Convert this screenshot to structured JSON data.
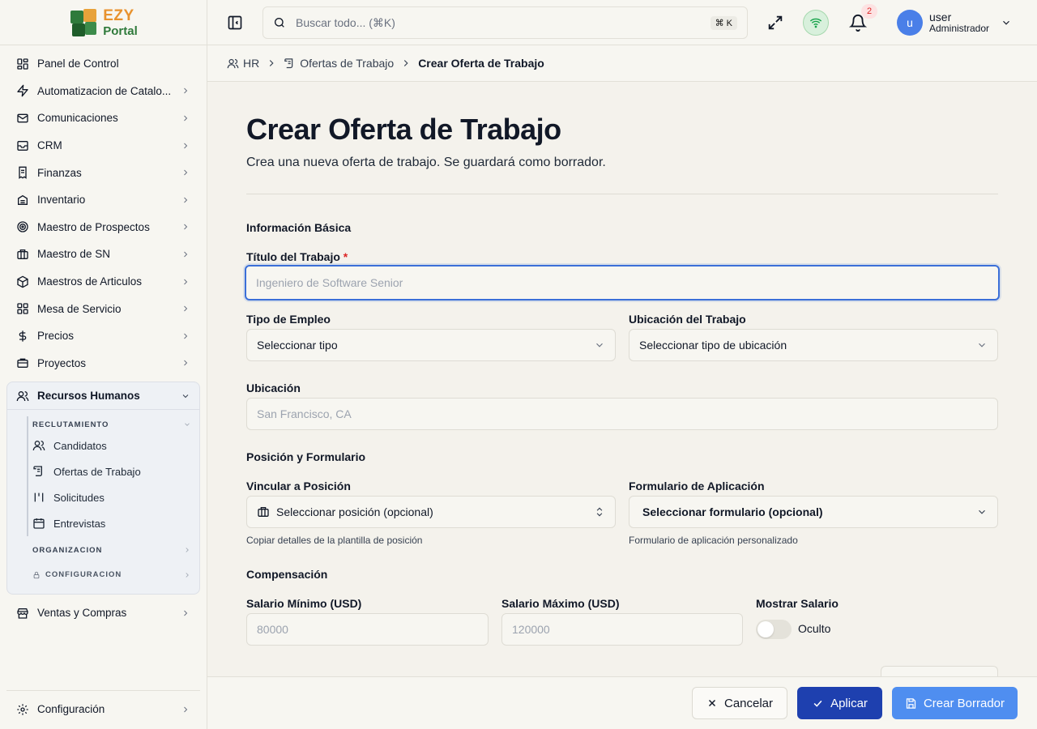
{
  "brand": {
    "line1": "EZY",
    "line2": "Portal"
  },
  "sidebar": {
    "items": [
      {
        "label": "Panel de Control",
        "icon": "dashboard-icon",
        "chevron": false
      },
      {
        "label": "Automatizacion de Catalo...",
        "icon": "zap-icon",
        "chevron": true
      },
      {
        "label": "Comunicaciones",
        "icon": "mail-icon",
        "chevron": true
      },
      {
        "label": "CRM",
        "icon": "inbox-icon",
        "chevron": true
      },
      {
        "label": "Finanzas",
        "icon": "receipt-icon",
        "chevron": true
      },
      {
        "label": "Inventario",
        "icon": "database-icon",
        "chevron": true
      },
      {
        "label": "Maestro de Prospectos",
        "icon": "target-icon",
        "chevron": true
      },
      {
        "label": "Maestro de SN",
        "icon": "briefcase-icon",
        "chevron": true
      },
      {
        "label": "Maestros de Articulos",
        "icon": "package-icon",
        "chevron": true
      },
      {
        "label": "Mesa de Servicio",
        "icon": "grid-icon",
        "chevron": true
      },
      {
        "label": "Precios",
        "icon": "dollar-icon",
        "chevron": true
      },
      {
        "label": "Proyectos",
        "icon": "folder-icon",
        "chevron": true
      }
    ],
    "hr": {
      "label": "Recursos Humanos",
      "reclutamiento": "RECLUTAMIENTO",
      "sub_items": [
        {
          "label": "Candidatos",
          "icon": "users-icon"
        },
        {
          "label": "Ofertas de Trabajo",
          "icon": "scroll-icon"
        },
        {
          "label": "Solicitudes",
          "icon": "columns-icon"
        },
        {
          "label": "Entrevistas",
          "icon": "calendar-icon"
        }
      ],
      "organizacion": "ORGANIZACION",
      "configuracion": "CONFIGURACION"
    },
    "after": {
      "label": "Ventas y Compras",
      "icon": "store-icon"
    },
    "bottom": {
      "label": "Configuración",
      "icon": "settings-icon"
    }
  },
  "topbar": {
    "search_placeholder": "Buscar todo... (⌘K)",
    "shortcut": "⌘ K",
    "notifications": "2",
    "user_initial": "u",
    "user_name": "user",
    "user_role": "Administrador"
  },
  "breadcrumb": [
    "HR",
    "Ofertas de Trabajo",
    "Crear Oferta de Trabajo"
  ],
  "page": {
    "title": "Crear Oferta de Trabajo",
    "subtitle": "Crea una nueva oferta de trabajo. Se guardará como borrador."
  },
  "form": {
    "basic_section": "Información Básica",
    "job_title_label": "Título del Trabajo",
    "required_mark": "*",
    "job_title_placeholder": "Ingeniero de Software Senior",
    "employment_type_label": "Tipo de Empleo",
    "employment_type_value": "Seleccionar tipo",
    "work_location_label": "Ubicación del Trabajo",
    "work_location_value": "Seleccionar tipo de ubicación",
    "location_label": "Ubicación",
    "location_placeholder": "San Francisco, CA",
    "position_section": "Posición y Formulario",
    "link_position_label": "Vincular a Posición",
    "link_position_value": "Seleccionar posición (opcional)",
    "link_position_help": "Copiar detalles de la plantilla de posición",
    "app_form_label": "Formulario de Aplicación",
    "app_form_value": "Seleccionar formulario (opcional)",
    "app_form_help": "Formulario de aplicación personalizado",
    "comp_section": "Compensación",
    "salary_min_label": "Salario Mínimo (USD)",
    "salary_min_placeholder": "80000",
    "salary_max_label": "Salario Máximo (USD)",
    "salary_max_placeholder": "120000",
    "show_salary_label": "Mostrar Salario",
    "show_salary_state": "Oculto",
    "show_salary_on": false
  },
  "footer": {
    "cancel": "Cancelar",
    "apply": "Aplicar",
    "draft": "Crear Borrador"
  },
  "colors": {
    "accent": "#1e40af",
    "primary_light": "#4f8ef0",
    "focus": "#3b6fd8",
    "brand_orange": "#e8922e",
    "brand_green": "#2f7a3b"
  }
}
